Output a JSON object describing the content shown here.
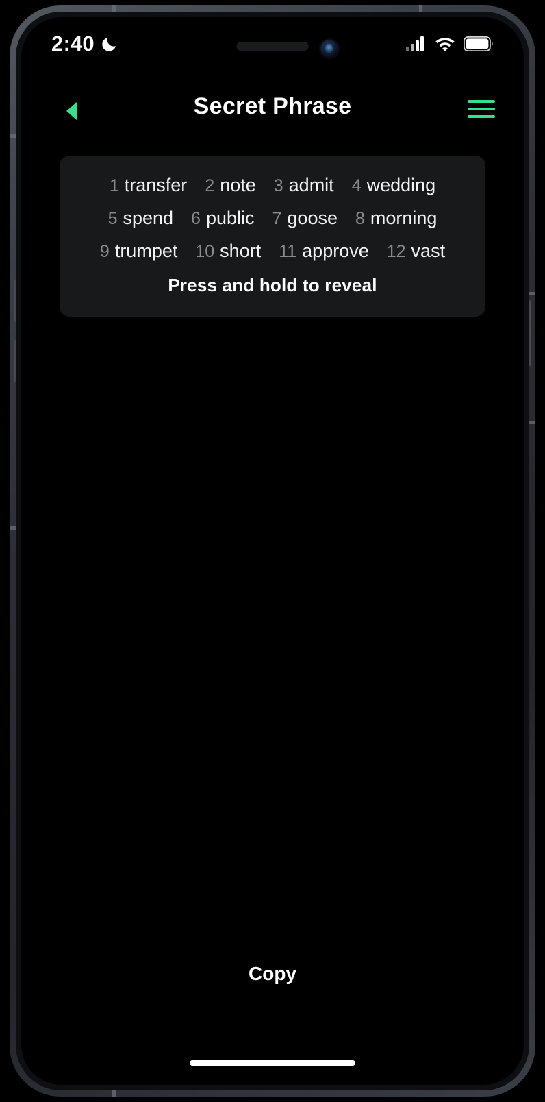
{
  "status_bar": {
    "time": "2:40",
    "dnd_icon": "crescent-moon-icon",
    "cellular_icon": "cellular-signal-icon",
    "cellular_bars_filled": 2,
    "cellular_bars_total": 4,
    "wifi_icon": "wifi-icon",
    "battery_icon": "battery-full-icon"
  },
  "header": {
    "back_icon": "back-triangle-icon",
    "title": "Secret Phrase",
    "menu_icon": "hamburger-menu-icon",
    "accent_color": "#35e08d"
  },
  "phrase_card": {
    "rows": [
      [
        {
          "index": "1",
          "word": "transfer"
        },
        {
          "index": "2",
          "word": "note"
        },
        {
          "index": "3",
          "word": "admit"
        },
        {
          "index": "4",
          "word": "wedding"
        }
      ],
      [
        {
          "index": "5",
          "word": "spend"
        },
        {
          "index": "6",
          "word": "public"
        },
        {
          "index": "7",
          "word": "goose"
        },
        {
          "index": "8",
          "word": "morning"
        }
      ],
      [
        {
          "index": "9",
          "word": "trumpet"
        },
        {
          "index": "10",
          "word": "short"
        },
        {
          "index": "11",
          "word": "approve"
        },
        {
          "index": "12",
          "word": "vast"
        }
      ]
    ],
    "reveal_hint": "Press and hold to reveal",
    "background_color": "#18191a",
    "index_color": "#8c8c8c",
    "word_color": "#f3f3f3"
  },
  "footer": {
    "copy_label": "Copy"
  }
}
